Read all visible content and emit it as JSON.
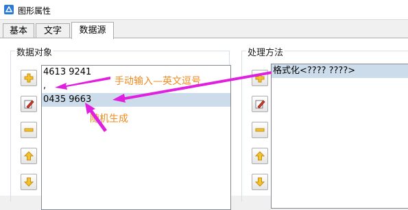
{
  "window": {
    "title": "图形属性",
    "icon": "app-shape-icon"
  },
  "tabs": [
    {
      "label": "基本",
      "active": false
    },
    {
      "label": "文字",
      "active": false
    },
    {
      "label": "数据源",
      "active": true
    }
  ],
  "data_objects": {
    "label": "数据对象",
    "items": [
      "4613 9241",
      ",",
      "0435 9663"
    ],
    "selected_index": 2,
    "buttons": [
      "add-icon",
      "edit-icon",
      "remove-icon",
      "move-up-icon",
      "move-down-icon"
    ]
  },
  "processing": {
    "label": "处理方法",
    "items": [
      "格式化<???? ????>"
    ],
    "selected_index": 0,
    "buttons": [
      "add-icon",
      "edit-icon",
      "remove-icon",
      "move-up-icon",
      "move-down-icon"
    ]
  },
  "annotations": {
    "manual": "手动输入—英文逗号",
    "random": "随机生成",
    "color": "#f08a1e",
    "arrow_color": "#e020e0"
  }
}
